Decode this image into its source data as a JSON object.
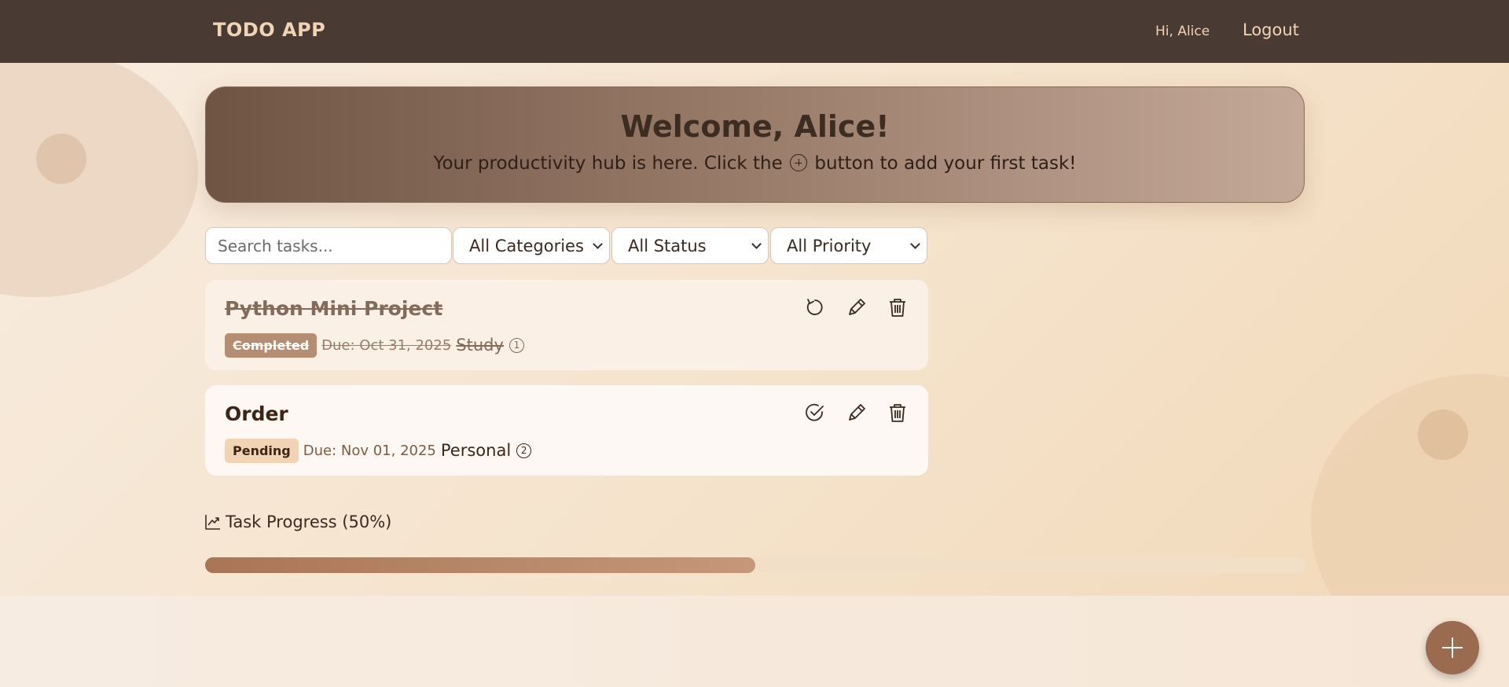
{
  "header": {
    "brand": "TODO APP",
    "greeting": "Hi, Alice",
    "logout_label": "Logout"
  },
  "banner": {
    "title": "Welcome, Alice!",
    "subtitle_before": "Your productivity hub is here. Click the",
    "subtitle_after": "button to add your first task!"
  },
  "filters": {
    "search_placeholder": "Search tasks...",
    "category": "All Categories",
    "status": "All Status",
    "priority": "All Priority"
  },
  "tasks": [
    {
      "title": "Python Mini Project",
      "status": "Completed",
      "due": "Due: Oct 31, 2025",
      "category": "Study",
      "priority": "1",
      "primary_action": "undo-icon"
    },
    {
      "title": "Order",
      "status": "Pending",
      "due": "Due: Nov 01, 2025",
      "category": "Personal",
      "priority": "2",
      "primary_action": "check-icon"
    }
  ],
  "progress": {
    "label": "Task Progress (50%)",
    "percent": 50
  },
  "colors": {
    "header_bg": "#493a33",
    "accent": "#9b6b4f",
    "brand_text": "#f1d3b5"
  }
}
